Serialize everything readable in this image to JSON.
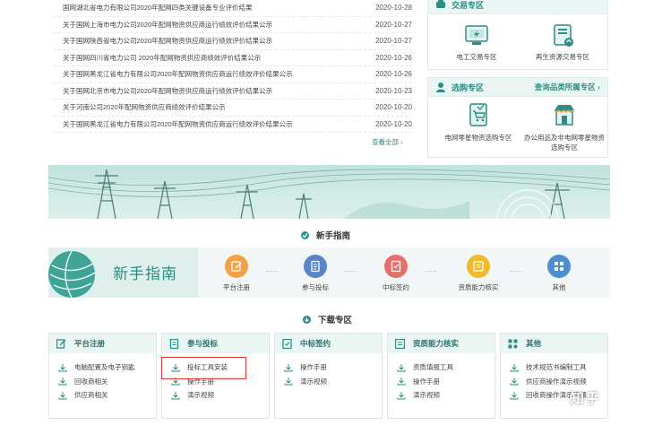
{
  "notices": [
    {
      "title": "国网湖北省电力有限公司2020年配网四类关键设备专业评价结果",
      "date": "2020-10-28"
    },
    {
      "title": "关于国网上海市电力公司2020年配网物资供应商运行绩效评价结果公示",
      "date": "2020-10-27"
    },
    {
      "title": "关于国网陕西省电力公司2020年配网物资供应商运行绩效评价结果公示",
      "date": "2020-10-27"
    },
    {
      "title": "关于国网四川省电力公司 2020年配网物资供应商绩效评价结果公示",
      "date": "2020-10-26"
    },
    {
      "title": "关于国网黑龙江省电力有限公司2020年配网物资供应商运行绩效评价结果公示",
      "date": "2020-10-26"
    },
    {
      "title": "关于国网北京市电力公司2020年配网物资供应商运行绩效评价结果公示",
      "date": "2020-10-23"
    },
    {
      "title": "关于河南公司2020年配网物资供应商绩效评价结果公示",
      "date": "2020-10-20"
    },
    {
      "title": "关于国网黑龙江省电力有限公司2020年配网物资供应商运行绩效评价结果公示",
      "date": "2020-10-20"
    }
  ],
  "see_all": "查看全部 ›",
  "trade_zone": {
    "title": "交易专区",
    "items": [
      "电工交易专区",
      "再生资源交易专区"
    ]
  },
  "select_zone": {
    "title": "选购专区",
    "more": "查询品类所属专区 ›",
    "items": [
      "电网零星物资选购专区",
      "办公用品及非电网零星物资选购专区"
    ]
  },
  "guide": {
    "section_title": "新手指南",
    "brand": "新手指南",
    "steps": [
      {
        "label": "平台注册",
        "color": "#f0a244",
        "icon": "edit-icon"
      },
      {
        "label": "参与投标",
        "color": "#5b85c9",
        "icon": "document-icon"
      },
      {
        "label": "中标签约",
        "color": "#e4706b",
        "icon": "contract-icon"
      },
      {
        "label": "资质能力核实",
        "color": "#f0bc2d",
        "icon": "stamp-icon"
      },
      {
        "label": "其他",
        "color": "#4d8ed3",
        "icon": "grid-icon"
      }
    ]
  },
  "download": {
    "section_title": "下载专区",
    "columns": [
      {
        "title": "平台注册",
        "items": [
          "电脑配置及电子钥匙",
          "回收商相关",
          "供应商相关"
        ]
      },
      {
        "title": "参与投标",
        "items": [
          "投标工具安装",
          "操作手册",
          "演示视频"
        ]
      },
      {
        "title": "中标签约",
        "items": [
          "操作手册",
          "演示视频"
        ]
      },
      {
        "title": "资质能力核实",
        "items": [
          "资质填报工具",
          "操作手册",
          "演示视频"
        ]
      },
      {
        "title": "其他",
        "items": [
          "技术规范书编制工具",
          "供应商操作演示视频",
          "回收商操作演示视频"
        ]
      }
    ]
  },
  "watermark": "知乎",
  "colors": {
    "accent": "#2d8d85",
    "highlight": "#e53a34"
  }
}
